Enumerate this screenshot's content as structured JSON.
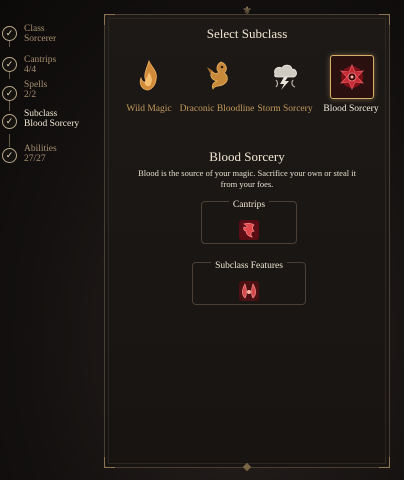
{
  "progression": {
    "steps": [
      {
        "label": "Class",
        "value": "Sorcerer",
        "done": true,
        "active": false
      },
      {
        "label": "Cantrips",
        "value": "4/4",
        "done": true,
        "active": false
      },
      {
        "label": "Spells",
        "value": "2/2",
        "done": true,
        "active": false
      },
      {
        "label": "Subclass",
        "value": "Blood Sorcery",
        "done": true,
        "active": true
      },
      {
        "label": "Abilities",
        "value": "27/27",
        "done": true,
        "active": false
      }
    ],
    "check_glyph": "✓"
  },
  "panel": {
    "emblem_glyph": "⚜",
    "title": "Select Subclass",
    "options": [
      {
        "label": "Wild Magic",
        "icon": "flame-icon",
        "selected": false
      },
      {
        "label": "Draconic Bloodline",
        "icon": "dragon-icon",
        "selected": false
      },
      {
        "label": "Storm Sorcery",
        "icon": "storm-icon",
        "selected": false
      },
      {
        "label": "Blood Sorcery",
        "icon": "blood-rune-icon",
        "selected": true
      }
    ],
    "detail": {
      "title": "Blood Sorcery",
      "description": "Blood is the source of your magic. Sacrifice your own or steal it from your foes."
    },
    "cantrips_box": {
      "title": "Cantrips",
      "icon": "blood-cantrip-icon"
    },
    "features_box": {
      "title": "Subclass Features",
      "icon": "blood-feature-icon"
    }
  },
  "colors": {
    "accent_gold": "#d7b06a",
    "label_gold": "#c49a5c",
    "blood_red": "#b3202a"
  }
}
